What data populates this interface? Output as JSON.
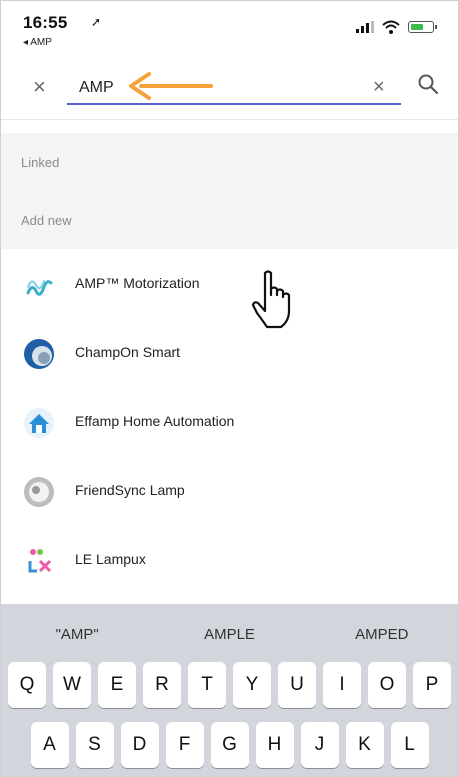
{
  "status_bar": {
    "time": "16:55",
    "location_arrow": "➚",
    "back_label": "◂ AMP",
    "icons": [
      "cellular-signal-icon",
      "wifi-icon",
      "battery-icon"
    ],
    "battery_color": "#3bbd4e"
  },
  "search": {
    "value": "AMP",
    "close_icon": "×",
    "clear_icon": "×",
    "search_icon": "magnifier",
    "underline_color": "#5a5fd6"
  },
  "annotation_arrow_color": "#f5a23b",
  "sections": {
    "linked_label": "Linked",
    "add_new_label": "Add new"
  },
  "results": [
    {
      "name": "AMP™ Motorization",
      "icon": "amp-motorization-icon"
    },
    {
      "name": "ChampOn Smart",
      "icon": "champon-smart-icon"
    },
    {
      "name": "Effamp Home Automation",
      "icon": "effamp-home-icon"
    },
    {
      "name": "FriendSync Lamp",
      "icon": "friendsync-lamp-icon"
    },
    {
      "name": "LE Lampux",
      "icon": "le-lampux-icon"
    }
  ],
  "keyboard": {
    "suggestions": [
      "\"AMP\"",
      "AMPLE",
      "AMPED"
    ],
    "row1": [
      "Q",
      "W",
      "E",
      "R",
      "T",
      "Y",
      "U",
      "I",
      "O",
      "P"
    ],
    "row2": [
      "A",
      "S",
      "D",
      "F",
      "G",
      "H",
      "J",
      "K",
      "L"
    ]
  }
}
